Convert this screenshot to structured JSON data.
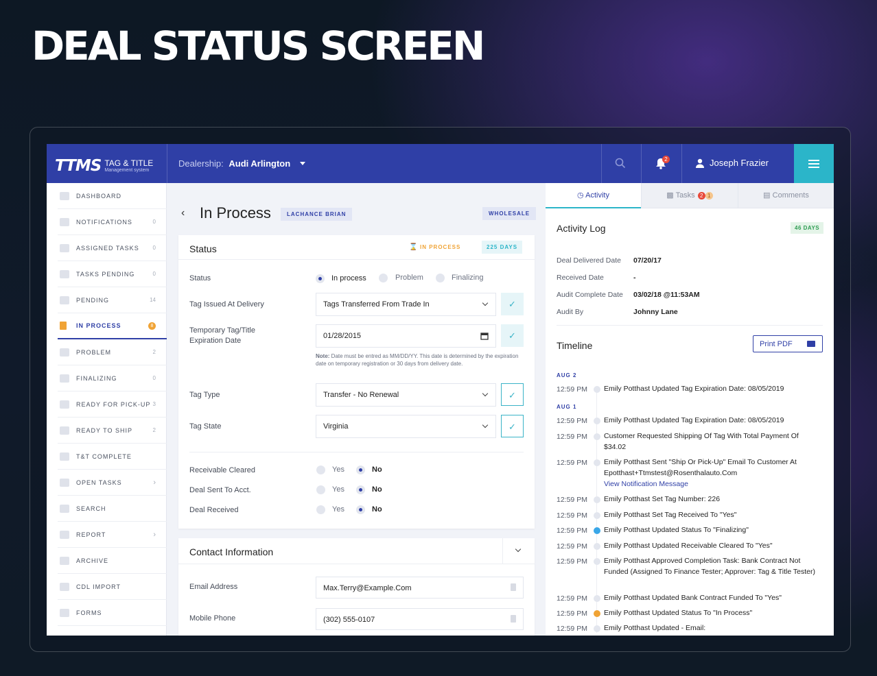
{
  "headline": "DEAL STATUS SCREEN",
  "topbar": {
    "logo_mark": "TTMS",
    "logo_line1": "TAG & TITLE",
    "logo_line2": "Management system",
    "dealership_label": "Dealership:",
    "dealership_value": "Audi Arlington",
    "notifications_count": "2",
    "user_name": "Joseph Frazier"
  },
  "sidebar": {
    "items": [
      {
        "label": "DASHBOARD",
        "count": ""
      },
      {
        "label": "NOTIFICATIONS",
        "count": "0"
      },
      {
        "label": "ASSIGNED TASKS",
        "count": "0"
      },
      {
        "label": "TASKS PENDING",
        "count": "0"
      },
      {
        "label": "PENDING",
        "count": "14"
      },
      {
        "label": "IN PROCESS",
        "count": "8"
      },
      {
        "label": "PROBLEM",
        "count": "2"
      },
      {
        "label": "FINALIZING",
        "count": "0"
      },
      {
        "label": "READY FOR PICK-UP",
        "count": "3"
      },
      {
        "label": "READY TO SHIP",
        "count": "2"
      },
      {
        "label": "T&T COMPLETE",
        "count": ""
      },
      {
        "label": "OPEN TASKS",
        "count": ""
      },
      {
        "label": "SEARCH",
        "count": ""
      },
      {
        "label": "REPORT",
        "count": ""
      },
      {
        "label": "ARCHIVE",
        "count": ""
      },
      {
        "label": "CDL IMPORT",
        "count": ""
      },
      {
        "label": "FORMS",
        "count": ""
      }
    ]
  },
  "main": {
    "title": "In Process",
    "owner_chip": "LACHANCE BRIAN",
    "type_chip": "WHOLESALE",
    "status_card": {
      "title": "Status",
      "status_tag": "IN PROCESS",
      "days_tag": "225 DAYS",
      "status_label": "Status",
      "status_options": [
        "In process",
        "Problem",
        "Finalizing"
      ],
      "tag_issued_label": "Tag Issued At Delivery",
      "tag_issued_value": "Tags Transferred From Trade In",
      "temp_tag_label": "Temporary Tag/Title Expiration Date",
      "temp_tag_value": "01/28/2015",
      "note_bold": "Note:",
      "note": " Date must be entred as MM/DD/YY. This date is determined by the expiration date on temporary registration or 30 days from delivery date.",
      "tag_type_label": "Tag Type",
      "tag_type_value": "Transfer - No Renewal",
      "tag_state_label": "Tag State",
      "tag_state_value": "Virginia",
      "yes": "Yes",
      "no": "No",
      "receivable_label": "Receivable Cleared",
      "deal_sent_label": "Deal Sent To Acct.",
      "deal_received_label": "Deal Received"
    },
    "contact_card": {
      "title": "Contact Information",
      "email_label": "Email Address",
      "email_value": "Max.Terry@Example.Com",
      "phone_label": "Mobile Phone",
      "phone_value": "(302) 555-0107"
    }
  },
  "right": {
    "tabs": {
      "activity": "Activity",
      "tasks": "Tasks",
      "tasks_badge_red": "2",
      "tasks_badge_orange": "1",
      "comments": "Comments"
    },
    "activity_log": {
      "title": "Activity Log",
      "days_chip": "46 DAYS",
      "rows": [
        {
          "label": "Deal Delivered Date",
          "value": "07/20/17"
        },
        {
          "label": "Received Date",
          "value": "-"
        },
        {
          "label": "Audit Complete Date",
          "value": "03/02/18 @11:53AM"
        },
        {
          "label": "Audit By",
          "value": "Johnny Lane"
        }
      ]
    },
    "timeline": {
      "title": "Timeline",
      "print_label": "Print PDF",
      "date1": "AUG 2",
      "date2": "AUG 1",
      "events": [
        {
          "time": "12:59 PM",
          "text": "Emily Potthast Updated Tag Expiration Date: 08/05/2019"
        },
        {
          "time": "12:59 PM",
          "text": "Emily Potthast Updated Tag Expiration Date: 08/05/2019"
        },
        {
          "time": "12:59 PM",
          "text": "Customer Requested Shipping Of Tag With Total Payment Of $34.02"
        },
        {
          "time": "12:59 PM",
          "text": "Emily Potthast Sent \"Ship Or Pick-Up\" Email To Customer At Epotthast+Ttmstest@Rosenthalauto.Com",
          "link": "View Notification Message"
        },
        {
          "time": "12:59 PM",
          "text": "Emily Potthast Set Tag Number: 226"
        },
        {
          "time": "12:59 PM",
          "text": "Emily Potthast Set Tag Received To \"Yes\""
        },
        {
          "time": "12:59 PM",
          "text": "Emily Potthast Updated Status To \"Finalizing\""
        },
        {
          "time": "12:59 PM",
          "text": "Emily Potthast Updated Receivable Cleared To \"Yes\""
        },
        {
          "time": "12:59 PM",
          "text": "Emily Potthast Approved Completion Task: Bank Contract Not Funded (Assigned To Finance Tester; Approver: Tag & Title Tester)"
        },
        {
          "time": "12:59 PM",
          "text": "Emily Potthast Updated Bank Contract Funded To \"Yes\""
        },
        {
          "time": "12:59 PM",
          "text": "Emily Potthast Updated Status To \"In Process\""
        },
        {
          "time": "12:59 PM",
          "text": "Emily Potthast Updated - Email:"
        }
      ]
    }
  },
  "colors": {
    "primary": "#2f3fa6",
    "accent": "#2bb5c9",
    "orange": "#f0a335",
    "blue_dot": "#3aa7e8",
    "green": "#2e9d52"
  }
}
